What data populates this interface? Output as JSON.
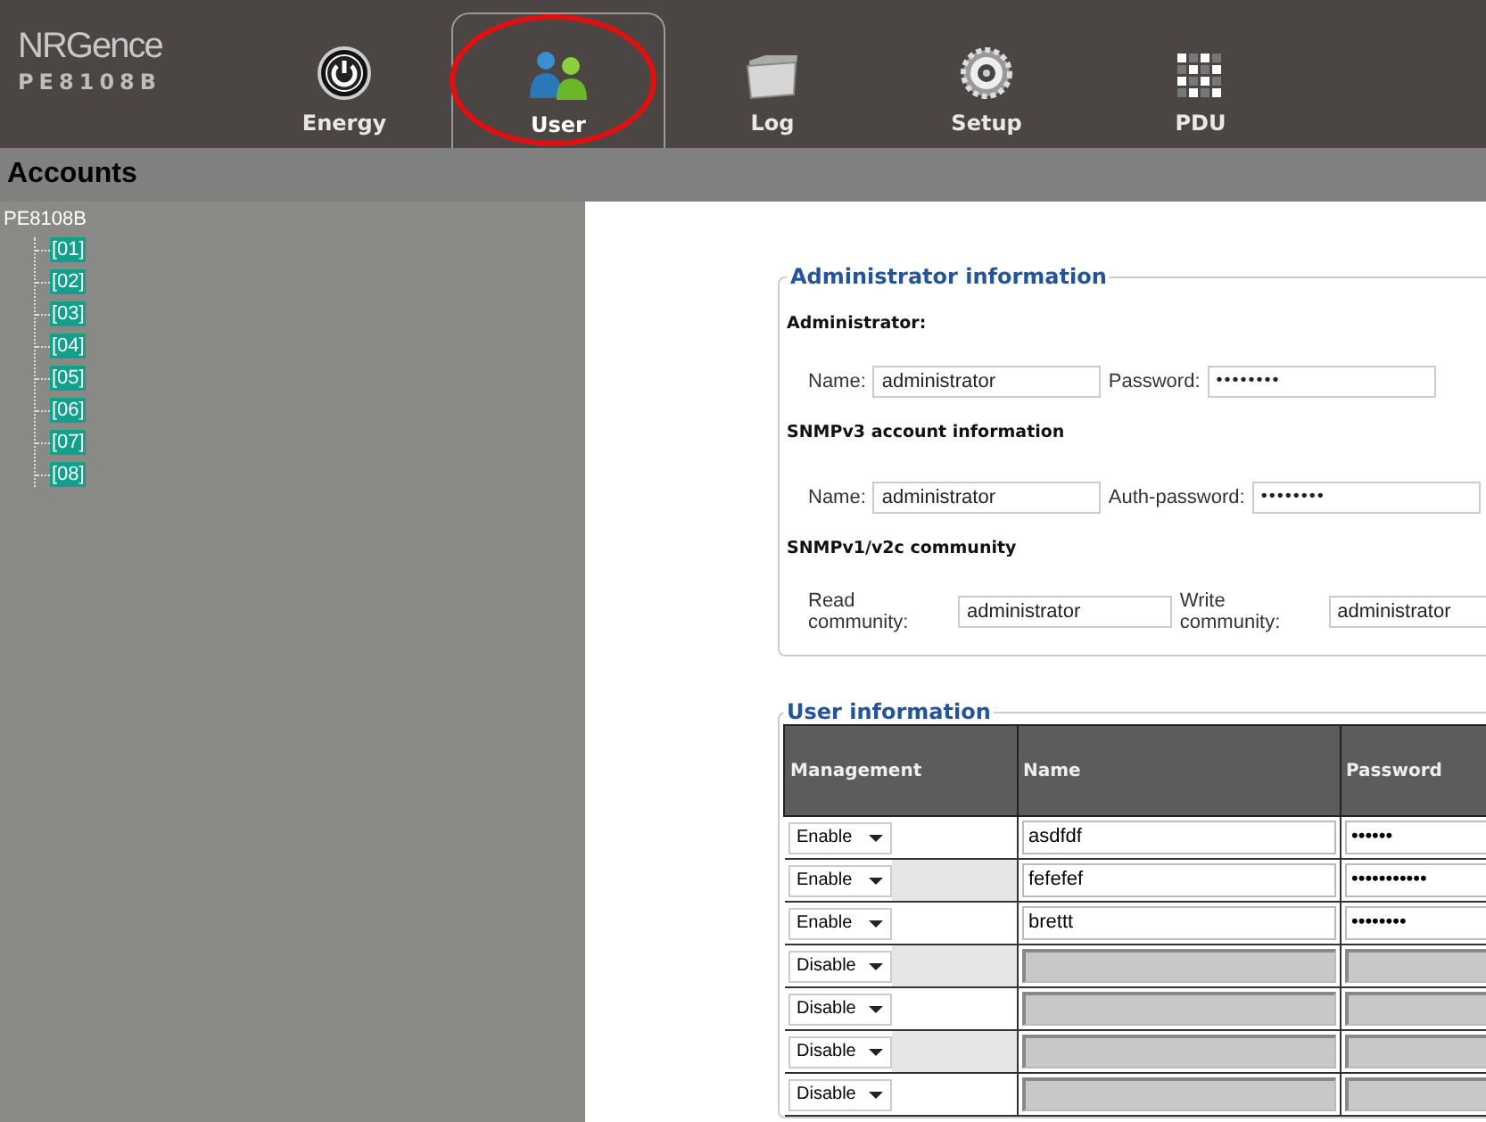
{
  "header": {
    "logo": "NRGence",
    "model": "PE8108B",
    "tabs": [
      {
        "label": "Energy",
        "kind": "energy",
        "selected": false
      },
      {
        "label": "User",
        "kind": "user",
        "selected": true
      },
      {
        "label": "Log",
        "kind": "log",
        "selected": false
      },
      {
        "label": "Setup",
        "kind": "setup",
        "selected": false
      },
      {
        "label": "PDU",
        "kind": "pdu",
        "selected": false
      }
    ]
  },
  "section_title": "Accounts",
  "tree": {
    "label": "PE8108B",
    "children": [
      {
        "label": "[01]"
      },
      {
        "label": "[02]"
      },
      {
        "label": "[03]"
      },
      {
        "label": "[04]"
      },
      {
        "label": "[05]"
      },
      {
        "label": "[06]"
      },
      {
        "label": "[07]"
      },
      {
        "label": "[08]"
      }
    ]
  },
  "admin": {
    "legend": "Administrator information",
    "groups": [
      {
        "heading": "Administrator:",
        "fields": [
          {
            "label": "Name:",
            "value": "administrator"
          },
          {
            "label": "Password:",
            "value": "••••••••"
          }
        ]
      },
      {
        "heading": "SNMPv3 account information",
        "fields": [
          {
            "label": "Name:",
            "value": "administrator"
          },
          {
            "label": "Auth-password:",
            "value": "••••••••"
          }
        ]
      },
      {
        "heading": "SNMPv1/v2c community",
        "fields": [
          {
            "label": "Read community:",
            "value": "administrator"
          },
          {
            "label": "Write community:",
            "value": "administrator"
          }
        ]
      }
    ]
  },
  "users": {
    "legend": "User information",
    "columns": [
      "Management",
      "Name",
      "Password"
    ],
    "rows": [
      {
        "management": "Enable",
        "name": "asdfdf",
        "password": "••••••",
        "disabled": false
      },
      {
        "management": "Enable",
        "name": "fefefef",
        "password": "•••••••••••",
        "disabled": false
      },
      {
        "management": "Enable",
        "name": "brettt",
        "password": "••••••••",
        "disabled": false
      },
      {
        "management": "Disable",
        "name": "",
        "password": "",
        "disabled": true
      },
      {
        "management": "Disable",
        "name": "",
        "password": "",
        "disabled": true
      },
      {
        "management": "Disable",
        "name": "",
        "password": "",
        "disabled": true
      },
      {
        "management": "Disable",
        "name": "",
        "password": "",
        "disabled": true
      }
    ]
  }
}
